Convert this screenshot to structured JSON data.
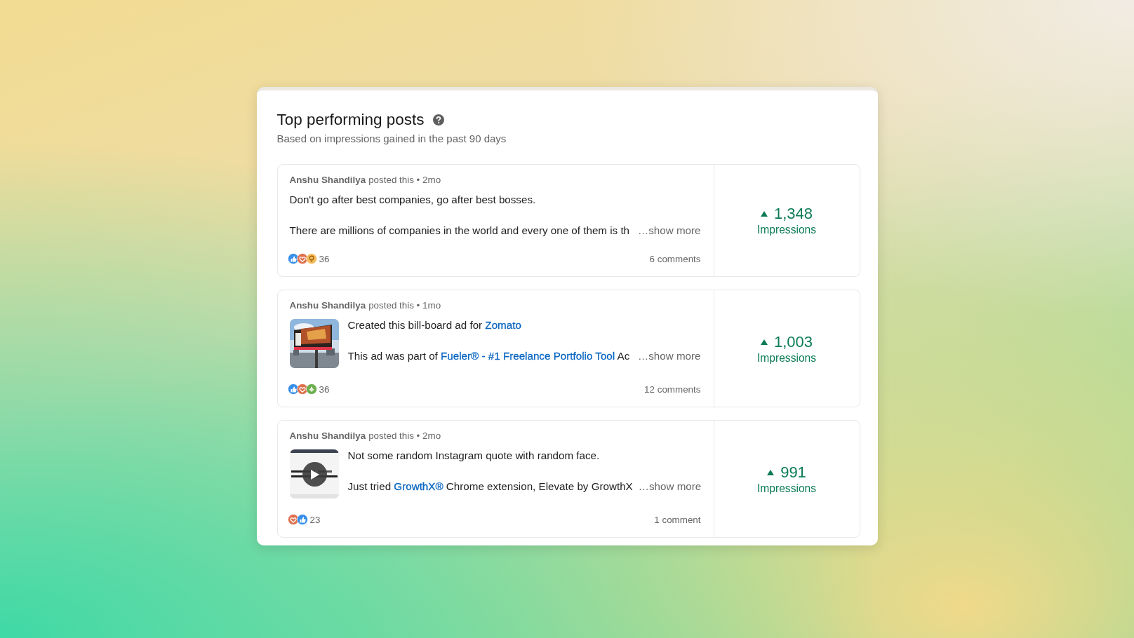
{
  "panel": {
    "title": "Top performing posts",
    "subtitle": "Based on impressions gained in the past 90 days"
  },
  "posts": [
    {
      "author": "Anshu Shandilya",
      "action": "posted this • 2mo",
      "lines": [
        [
          {
            "kind": "text",
            "text": "Don't go after best companies, go after best bosses."
          }
        ],
        [
          {
            "kind": "text",
            "text": "There are millions of companies in the world and every one of them is th"
          }
        ]
      ],
      "show_more": "…show more",
      "reactions": [
        {
          "kind": "like"
        },
        {
          "kind": "love"
        },
        {
          "kind": "insight"
        }
      ],
      "reaction_count": "36",
      "comments": "6 comments",
      "impressions": "1,348",
      "impressions_label": "Impressions"
    },
    {
      "author": "Anshu Shandilya",
      "action": "posted this • 1mo",
      "thumbnail": {
        "kind": "picture",
        "video": false
      },
      "lines": [
        [
          {
            "kind": "text",
            "text": "Created this bill-board ad for "
          },
          {
            "kind": "link",
            "text": "Zomato"
          }
        ],
        [
          {
            "kind": "text",
            "text": "This ad was part of "
          },
          {
            "kind": "link",
            "text": "Fueler® - #1 Freelance Portfolio Tool"
          },
          {
            "kind": "text",
            "text": " Ac"
          }
        ]
      ],
      "show_more": "…show more",
      "reactions": [
        {
          "kind": "like"
        },
        {
          "kind": "love"
        },
        {
          "kind": "support"
        }
      ],
      "reaction_count": "36",
      "comments": "12 comments",
      "impressions": "1,003",
      "impressions_label": "Impressions"
    },
    {
      "author": "Anshu Shandilya",
      "action": "posted this • 2mo",
      "thumbnail": {
        "kind": "picture",
        "video": true
      },
      "lines": [
        [
          {
            "kind": "text",
            "text": "Not some random Instagram quote with random face."
          }
        ],
        [
          {
            "kind": "text",
            "text": "Just tried "
          },
          {
            "kind": "link",
            "text": "GrowthX®"
          },
          {
            "kind": "text",
            "text": " Chrome extension, Elevate by GrowthX"
          }
        ]
      ],
      "show_more": "…show more",
      "reactions": [
        {
          "kind": "love"
        },
        {
          "kind": "like"
        }
      ],
      "reaction_count": "23",
      "comments": "1 comment",
      "impressions": "991",
      "impressions_label": "Impressions"
    }
  ]
}
